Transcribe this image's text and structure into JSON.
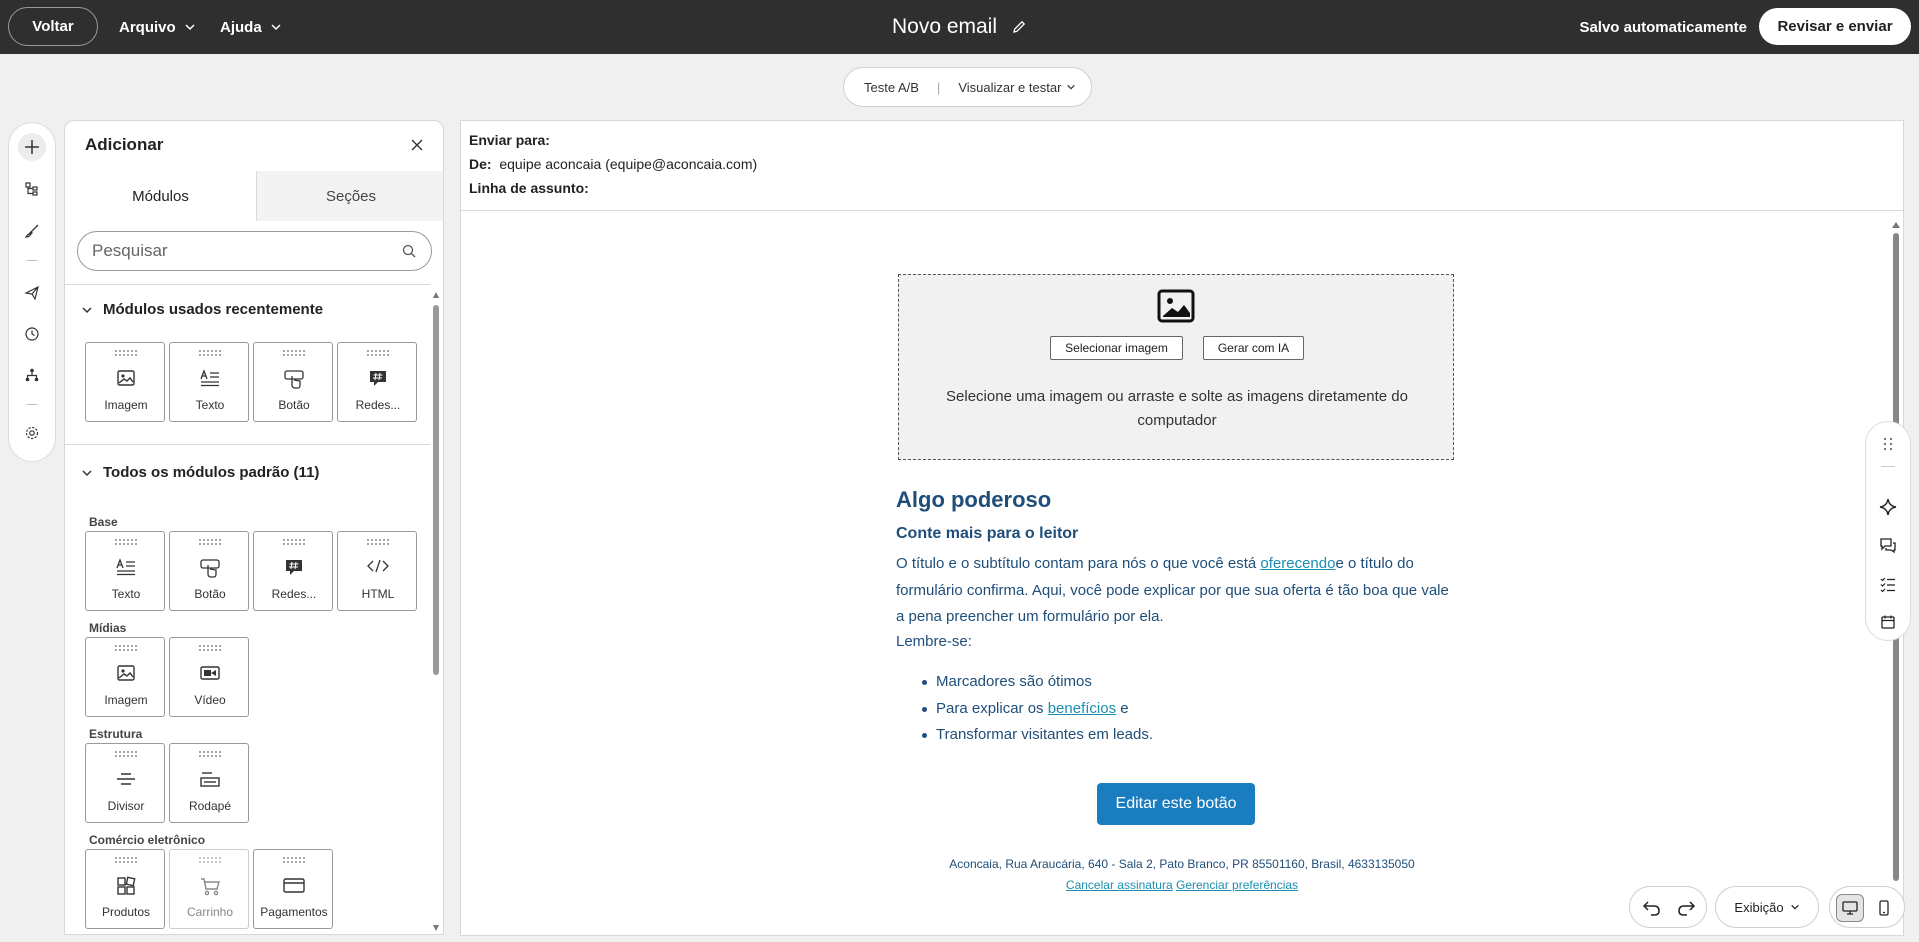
{
  "topbar": {
    "back_label": "Voltar",
    "menu_file": "Arquivo",
    "menu_help": "Ajuda",
    "title": "Novo email",
    "autosave": "Salvo automaticamente",
    "review_label": "Revisar e enviar"
  },
  "toolbar": {
    "ab_test": "Teste A/B",
    "preview": "Visualizar e testar"
  },
  "left_rail": {
    "icons": [
      "plus-icon",
      "tree-icon",
      "brush-icon",
      "send-icon",
      "clock-icon",
      "workflow-icon",
      "gear-icon"
    ]
  },
  "panel": {
    "title": "Adicionar",
    "tabs": [
      "Módulos",
      "Seções"
    ],
    "active_tab": "Módulos",
    "search_placeholder": "Pesquisar",
    "recent_header": "Módulos usados recentemente",
    "recent": [
      "Imagem",
      "Texto",
      "Botão",
      "Redes..."
    ],
    "all_header": "Todos os módulos padrão (11)",
    "groups": [
      {
        "label": "Base",
        "items": [
          "Texto",
          "Botão",
          "Redes...",
          "HTML"
        ]
      },
      {
        "label": "Mídias",
        "items": [
          "Imagem",
          "Vídeo"
        ]
      },
      {
        "label": "Estrutura",
        "items": [
          "Divisor",
          "Rodapé"
        ]
      },
      {
        "label": "Comércio eletrônico",
        "items": [
          "Produtos",
          "Carrinho",
          "Pagamentos"
        ]
      }
    ]
  },
  "email": {
    "to_label": "Enviar para:",
    "to_value": "",
    "from_label": "De:",
    "from_value": "equipe aconcaia (equipe@aconcaia.com)",
    "subject_label": "Linha de assunto:",
    "subject_value": "",
    "image": {
      "select_label": "Selecionar imagem",
      "ai_label": "Gerar com IA",
      "hint": "Selecione uma imagem ou arraste e solte as imagens diretamente do computador"
    },
    "heading": "Algo poderoso",
    "subheading": "Conte mais para o leitor",
    "para_part1": "O título e o subtítulo contam para nós o que você está ",
    "para_link": "oferecendo",
    "para_part2": "e o título do formulário confirma. Aqui, você pode explicar por que sua oferta é tão boa que vale a pena preencher um formulário por ela.",
    "remember": "Lembre-se:",
    "bullet1": "Marcadores são ótimos",
    "bullet2_pre": "Para explicar os ",
    "bullet2_link": "benefícios",
    "bullet2_post": " e",
    "bullet3": "Transformar visitantes em leads.",
    "cta": "Editar este botão",
    "footer_address": "Aconcaia, Rua Araucária, 640 - Sala 2, Pato Branco, PR 85501160, Brasil, 4633135050",
    "footer_unsub": "Cancelar assinatura",
    "footer_prefs": "Gerenciar preferências"
  },
  "bottom": {
    "display_label": "Exibição"
  },
  "colors": {
    "topbar_bg": "#2f2f2f",
    "email_text": "#1f4e79",
    "link": "#1a8fb0",
    "cta_bg": "#1a7dc0"
  }
}
